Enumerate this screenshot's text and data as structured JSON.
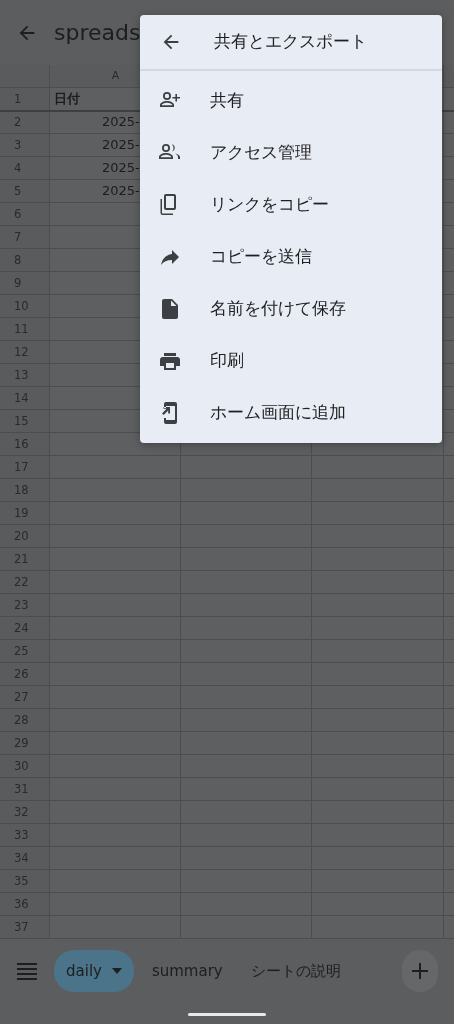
{
  "app_bar": {
    "title": "spreads"
  },
  "grid": {
    "columns": [
      "A"
    ],
    "rows": [
      {
        "number": "1",
        "cells": [
          "日付"
        ],
        "header": true
      },
      {
        "number": "2",
        "cells": [
          "2025-"
        ]
      },
      {
        "number": "3",
        "cells": [
          "2025-"
        ]
      },
      {
        "number": "4",
        "cells": [
          "2025-"
        ]
      },
      {
        "number": "5",
        "cells": [
          "2025-"
        ]
      },
      {
        "number": "6"
      },
      {
        "number": "7"
      },
      {
        "number": "8"
      },
      {
        "number": "9"
      },
      {
        "number": "10"
      },
      {
        "number": "11"
      },
      {
        "number": "12"
      },
      {
        "number": "13"
      },
      {
        "number": "14"
      },
      {
        "number": "15"
      },
      {
        "number": "16"
      },
      {
        "number": "17"
      },
      {
        "number": "18"
      },
      {
        "number": "19"
      },
      {
        "number": "20"
      },
      {
        "number": "21"
      },
      {
        "number": "22"
      },
      {
        "number": "23"
      },
      {
        "number": "24"
      },
      {
        "number": "25"
      },
      {
        "number": "26"
      },
      {
        "number": "27"
      },
      {
        "number": "28"
      },
      {
        "number": "29"
      },
      {
        "number": "30"
      },
      {
        "number": "31"
      },
      {
        "number": "32"
      },
      {
        "number": "33"
      },
      {
        "number": "34"
      },
      {
        "number": "35"
      },
      {
        "number": "36"
      },
      {
        "number": "37"
      }
    ]
  },
  "menu": {
    "title": "共有とエクスポート",
    "items": [
      {
        "label": "共有",
        "kind": "share"
      },
      {
        "label": "アクセス管理",
        "kind": "access"
      },
      {
        "label": "リンクをコピー",
        "kind": "link"
      },
      {
        "label": "コピーを送信",
        "kind": "send"
      },
      {
        "label": "名前を付けて保存",
        "kind": "save"
      },
      {
        "label": "印刷",
        "kind": "print"
      },
      {
        "label": "ホーム画面に追加",
        "kind": "home"
      }
    ]
  },
  "sheet_tabs": [
    {
      "label": "daily",
      "selected": true
    },
    {
      "label": "summary",
      "selected": false
    },
    {
      "label": "シートの説明",
      "selected": false
    }
  ]
}
